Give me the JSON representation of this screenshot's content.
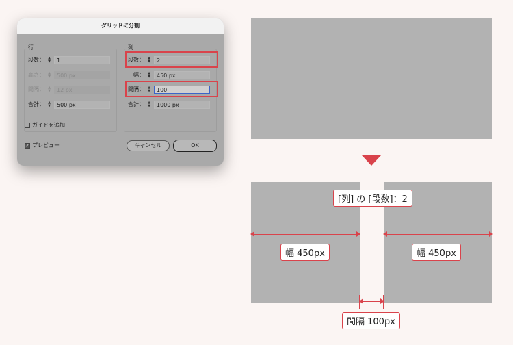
{
  "dialog": {
    "title": "グリッドに分割",
    "rows": {
      "group_title": "行",
      "count_label": "段数：",
      "count_value": "1",
      "height_label": "高さ：",
      "height_value": "500 px",
      "gutter_label": "間隔：",
      "gutter_value": "12 px",
      "total_label": "合計：",
      "total_value": "500 px"
    },
    "columns": {
      "group_title": "列",
      "count_label": "段数：",
      "count_value": "2",
      "width_label": "幅：",
      "width_value": "450 px",
      "gutter_label": "間隔：",
      "gutter_value": "100",
      "total_label": "合計：",
      "total_value": "1000 px"
    },
    "add_guides_label": "ガイドを追加",
    "preview_label": "プレビュー",
    "cancel_label": "キャンセル",
    "ok_label": "OK"
  },
  "illustration": {
    "columns_label": "[列] の [段数]：2",
    "left_width_label": "幅 450px",
    "right_width_label": "幅 450px",
    "gutter_label": "間隔 100px",
    "accent_color": "#d9434b"
  }
}
